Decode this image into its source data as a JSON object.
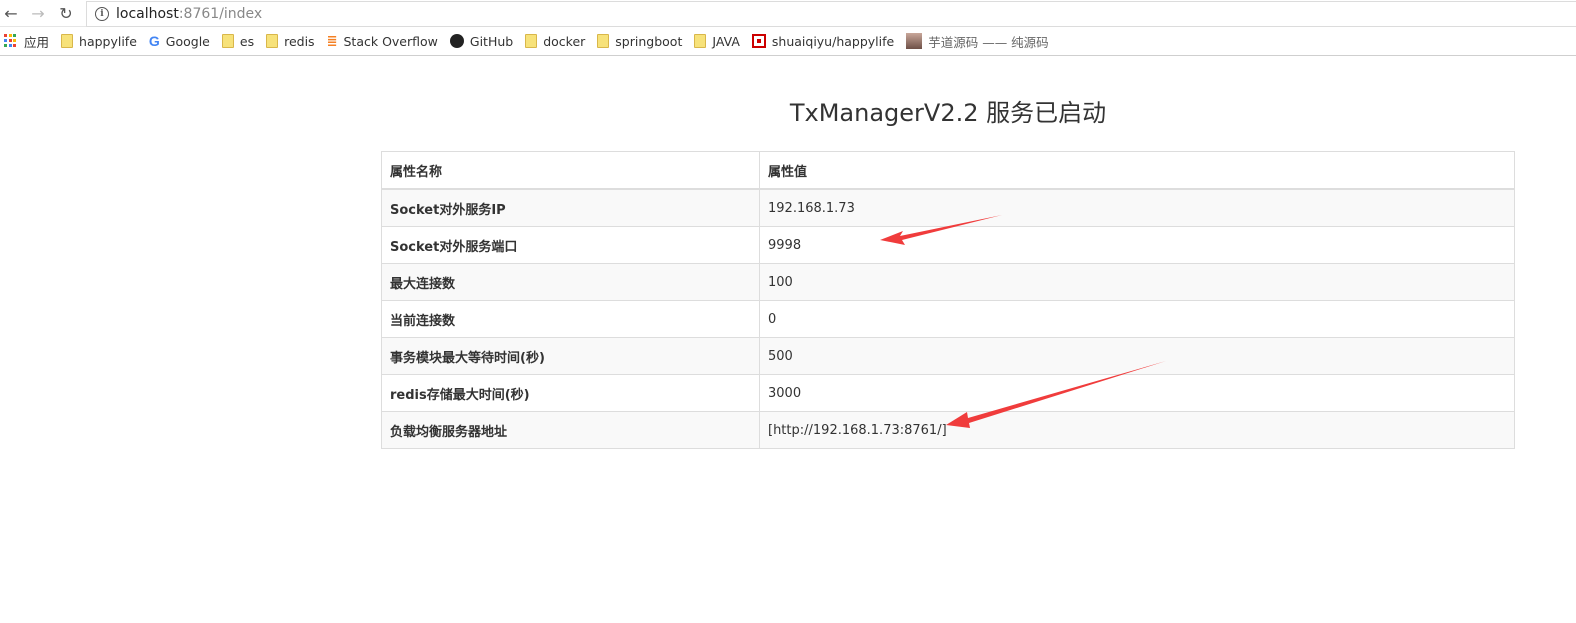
{
  "browser": {
    "url_host": "localhost",
    "url_rest": ":8761/index",
    "nav": {
      "back": "←",
      "forward": "→",
      "reload": "↻"
    },
    "bookmarks": [
      {
        "label": "应用",
        "icon": "apps-icon"
      },
      {
        "label": "happylife",
        "icon": "folder-icon"
      },
      {
        "label": "Google",
        "icon": "google-icon"
      },
      {
        "label": "es",
        "icon": "folder-icon"
      },
      {
        "label": "redis",
        "icon": "folder-icon"
      },
      {
        "label": "Stack Overflow",
        "icon": "stackoverflow-icon"
      },
      {
        "label": "GitHub",
        "icon": "github-icon"
      },
      {
        "label": "docker",
        "icon": "folder-icon"
      },
      {
        "label": "springboot",
        "icon": "folder-icon"
      },
      {
        "label": "JAVA",
        "icon": "folder-icon"
      },
      {
        "label": "shuaiqiyu/happylife",
        "icon": "cnblogs-icon"
      },
      {
        "label": "芋道源码 —— 纯源码",
        "icon": "avatar-icon"
      }
    ]
  },
  "page": {
    "title": "TxManagerV2.2 服务已启动",
    "table": {
      "headers": [
        "属性名称",
        "属性值"
      ],
      "rows": [
        {
          "name": "Socket对外服务IP",
          "value": "192.168.1.73"
        },
        {
          "name": "Socket对外服务端口",
          "value": "9998"
        },
        {
          "name": "最大连接数",
          "value": "100"
        },
        {
          "name": "当前连接数",
          "value": "0"
        },
        {
          "name": "事务模块最大等待时间(秒)",
          "value": "500"
        },
        {
          "name": "redis存储最大时间(秒)",
          "value": "3000"
        },
        {
          "name": "负载均衡服务器地址",
          "value": "[http://192.168.1.73:8761/]"
        }
      ]
    }
  },
  "annotations": {
    "arrow_color": "#f03c3c"
  }
}
